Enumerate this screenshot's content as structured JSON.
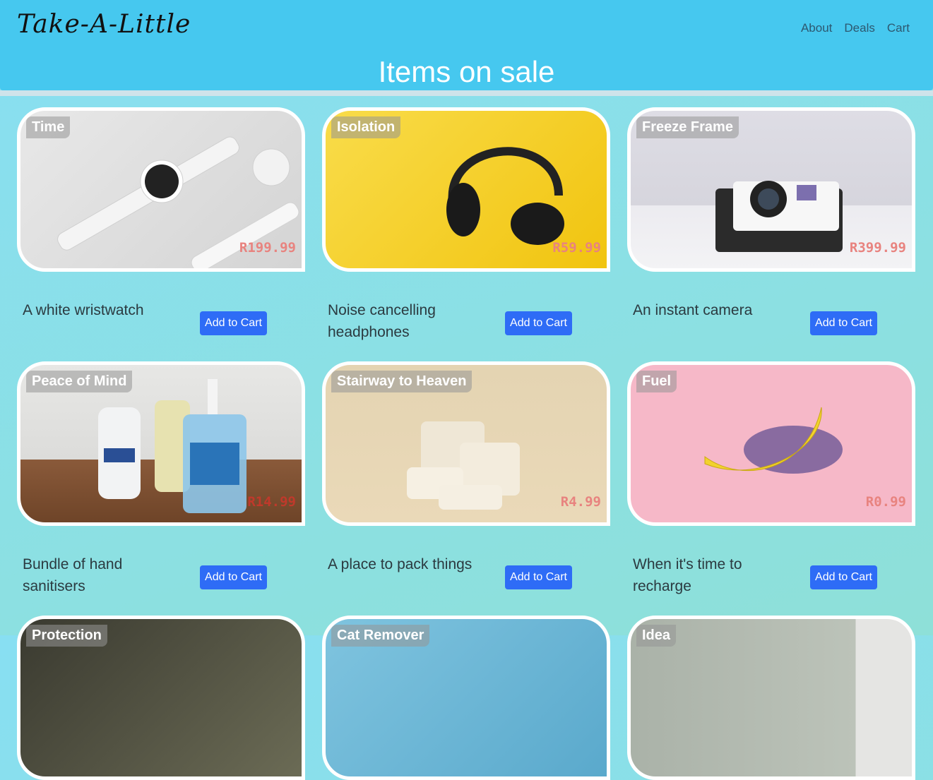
{
  "header": {
    "brand": "Take-A-Little",
    "nav": [
      "About",
      "Deals",
      "Cart"
    ],
    "title": "Items on sale"
  },
  "items": [
    {
      "tag": "Time",
      "price": "R199.99",
      "desc": "A white wristwatch",
      "button": "Add to Cart"
    },
    {
      "tag": "Isolation",
      "price": "R59.99",
      "desc": "Noise cancelling headphones",
      "button": "Add to Cart"
    },
    {
      "tag": "Freeze Frame",
      "price": "R399.99",
      "desc": "An instant camera",
      "button": "Add to Cart"
    },
    {
      "tag": "Peace of Mind",
      "price": "R14.99",
      "desc": "Bundle of hand sanitisers",
      "button": "Add to Cart"
    },
    {
      "tag": "Stairway to Heaven",
      "price": "R4.99",
      "desc": "A place to pack things",
      "button": "Add to Cart"
    },
    {
      "tag": "Fuel",
      "price": "R0.99",
      "desc": "When it's time to recharge",
      "button": "Add to Cart"
    },
    {
      "tag": "Protection"
    },
    {
      "tag": "Cat Remover"
    },
    {
      "tag": "Idea"
    }
  ],
  "colors": {
    "header_bg": "#46c8ef",
    "button": "#2e6cf6",
    "price": "#e8837f"
  }
}
